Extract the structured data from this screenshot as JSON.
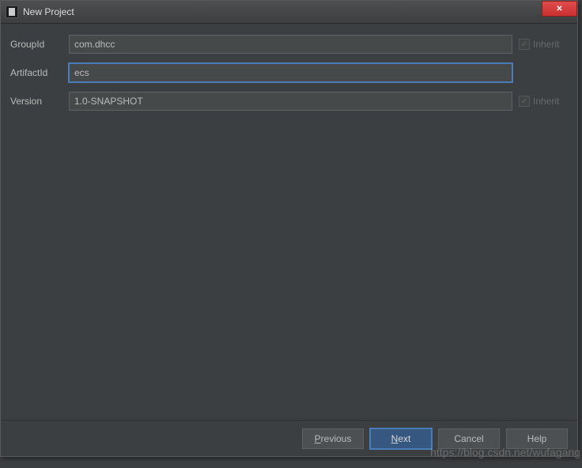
{
  "window": {
    "title": "New Project"
  },
  "form": {
    "groupId": {
      "label": "GroupId",
      "value": "com.dhcc",
      "inheritLabel": "Inherit",
      "inheritChecked": true
    },
    "artifactId": {
      "label": "ArtifactId",
      "value": "ecs"
    },
    "version": {
      "label": "Version",
      "value": "1.0-SNAPSHOT",
      "inheritLabel": "Inherit",
      "inheritChecked": true
    }
  },
  "buttons": {
    "previous": "Previous",
    "next": "Next",
    "cancel": "Cancel",
    "help": "Help"
  },
  "watermark": "https://blog.csdn.net/wufagang"
}
